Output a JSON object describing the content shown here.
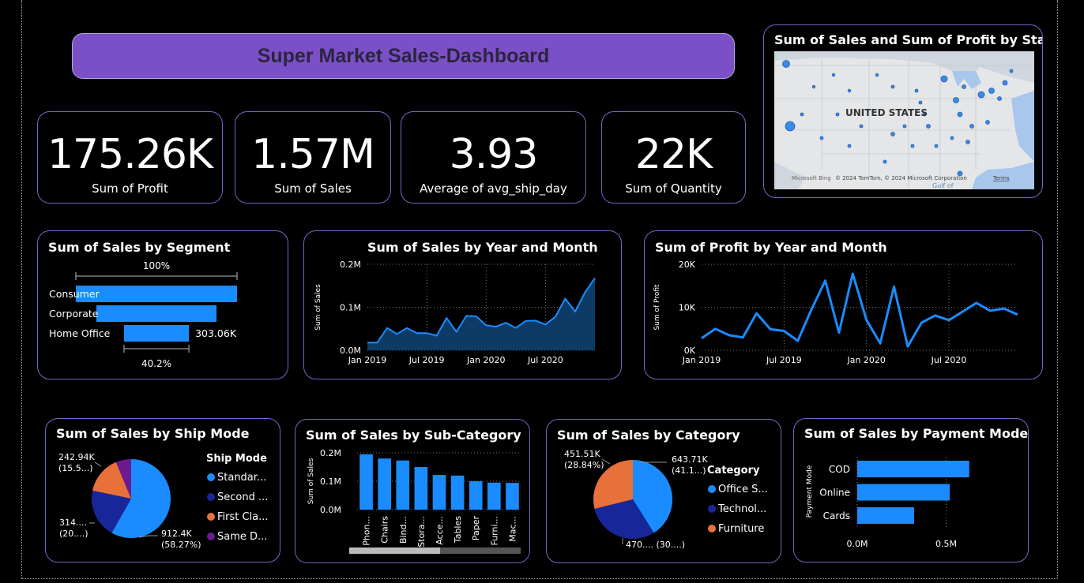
{
  "dashboard": {
    "title": "Super Market Sales-Dashboard"
  },
  "kpis": [
    {
      "value": "175.26K",
      "label": "Sum of Profit"
    },
    {
      "value": "1.57M",
      "label": "Sum of Sales"
    },
    {
      "value": "3.93",
      "label": "Average of avg_ship_day"
    },
    {
      "value": "22K",
      "label": "Sum of Quantity"
    }
  ],
  "map": {
    "title": "Sum of Sales and Sum of Profit by State",
    "country_label": "UNITED STATES",
    "attribution": "© 2024 TomTom, © 2024 Microsoft Corporation",
    "terms": "Terms",
    "brand": "Microsoft Bing",
    "gulf": "Gulf of"
  },
  "colors": {
    "accent": "#1a8cff",
    "navy": "#17279a",
    "orange": "#e8703a",
    "purple": "#6b1a8f",
    "card_border": "#6f68c8",
    "title_bg": "#7b4fc6"
  },
  "chart_data": [
    {
      "id": "segment",
      "type": "funnel",
      "title": "Sum of Sales by Segment",
      "categories": [
        "Consumer",
        "Corporate",
        "Home Office"
      ],
      "values": [
        752.5,
        560.8,
        303.06
      ],
      "top_label": "100%",
      "bottom_label": "40.2%",
      "value_label": "303.06K"
    },
    {
      "id": "sales_month",
      "type": "area",
      "title": "Sum of Sales by Year and Month",
      "ylabel": "Sum of Sales",
      "xlabel": "",
      "x_ticks": [
        "Jan 2019",
        "Jul 2019",
        "Jan 2020",
        "Jul 2020"
      ],
      "y_ticks": [
        "0.0M",
        "0.1M",
        "0.2M"
      ],
      "ylim": [
        0,
        0.2
      ],
      "x": [
        "2019-01",
        "2019-02",
        "2019-03",
        "2019-04",
        "2019-05",
        "2019-06",
        "2019-07",
        "2019-08",
        "2019-09",
        "2019-10",
        "2019-11",
        "2019-12",
        "2020-01",
        "2020-02",
        "2020-03",
        "2020-04",
        "2020-05",
        "2020-06",
        "2020-07",
        "2020-08",
        "2020-09",
        "2020-10",
        "2020-11",
        "2020-12"
      ],
      "values": [
        0.018,
        0.018,
        0.052,
        0.038,
        0.052,
        0.04,
        0.04,
        0.034,
        0.075,
        0.043,
        0.08,
        0.079,
        0.058,
        0.055,
        0.064,
        0.052,
        0.068,
        0.069,
        0.06,
        0.078,
        0.12,
        0.09,
        0.135,
        0.168
      ]
    },
    {
      "id": "profit_month",
      "type": "line",
      "title": "Sum of Profit by Year and Month",
      "ylabel": "Sum of Profit",
      "xlabel": "",
      "x_ticks": [
        "Jan 2019",
        "Jul 2019",
        "Jan 2020",
        "Jul 2020"
      ],
      "y_ticks": [
        "0K",
        "10K",
        "20K"
      ],
      "ylim": [
        0,
        20000
      ],
      "x": [
        "2019-01",
        "2019-02",
        "2019-03",
        "2019-04",
        "2019-05",
        "2019-06",
        "2019-07",
        "2019-08",
        "2019-09",
        "2019-10",
        "2019-11",
        "2019-12",
        "2020-01",
        "2020-02",
        "2020-03",
        "2020-04",
        "2020-05",
        "2020-06",
        "2020-07",
        "2020-08",
        "2020-09",
        "2020-10",
        "2020-11",
        "2020-12"
      ],
      "values": [
        2800,
        5000,
        3500,
        3000,
        8600,
        4900,
        4500,
        2200,
        9500,
        16200,
        4100,
        17800,
        7000,
        1600,
        14800,
        900,
        6400,
        8100,
        7000,
        9000,
        11000,
        9200,
        9700,
        8300
      ]
    },
    {
      "id": "ship_mode",
      "type": "pie",
      "title": "Sum of Sales by Ship Mode",
      "legend_title": "Ship Mode",
      "legend_placement": "right",
      "series": [
        {
          "name": "Standar...",
          "value": 912.4,
          "color": "#1a8cff"
        },
        {
          "name": "Second ...",
          "value": 314.3,
          "color": "#17279a"
        },
        {
          "name": "First Cla...",
          "value": 242.94,
          "color": "#e8703a"
        },
        {
          "name": "Same D...",
          "value": 98.0,
          "color": "#6b1a8f"
        }
      ],
      "data_labels": [
        {
          "line1": "912.4K",
          "line2": "(58.27%)"
        },
        {
          "line1": "314....",
          "line2": "(20....)"
        },
        {
          "line1": "242.94K",
          "line2": "(15.5...)"
        }
      ]
    },
    {
      "id": "sub_category",
      "type": "bar",
      "title": "Sum of Sales by Sub-Category",
      "ylabel": "Sum of Sales",
      "y_ticks": [
        "0.0M",
        "0.1M",
        "0.2M"
      ],
      "ylim": [
        0,
        0.2
      ],
      "categories": [
        "Phon...",
        "Chairs",
        "Bind...",
        "Stora...",
        "Acce...",
        "Tables",
        "Paper",
        "Furni...",
        "Mac..."
      ],
      "values": [
        0.195,
        0.18,
        0.173,
        0.15,
        0.122,
        0.12,
        0.1,
        0.095,
        0.094
      ]
    },
    {
      "id": "category",
      "type": "pie",
      "title": "Sum of Sales by Category",
      "legend_title": "Category",
      "legend_placement": "right",
      "series": [
        {
          "name": "Office S...",
          "value": 643.71,
          "color": "#1a8cff"
        },
        {
          "name": "Technol...",
          "value": 470.3,
          "color": "#17279a"
        },
        {
          "name": "Furniture",
          "value": 451.51,
          "color": "#e8703a"
        }
      ],
      "data_labels": [
        {
          "line1": "643.71K",
          "line2": "(41.1...)"
        },
        {
          "line1": "470.... (30....)",
          "line2": ""
        },
        {
          "line1": "451.51K",
          "line2": "(28.84%)"
        }
      ]
    },
    {
      "id": "payment_mode",
      "type": "hbar",
      "title": "Sum of Sales by Payment Mode",
      "ylabel": "Payment Mode",
      "x_ticks": [
        "0.0M",
        "0.5M"
      ],
      "xlim": [
        0,
        0.8
      ],
      "categories": [
        "COD",
        "Online",
        "Cards"
      ],
      "values": [
        0.63,
        0.52,
        0.32
      ]
    }
  ]
}
